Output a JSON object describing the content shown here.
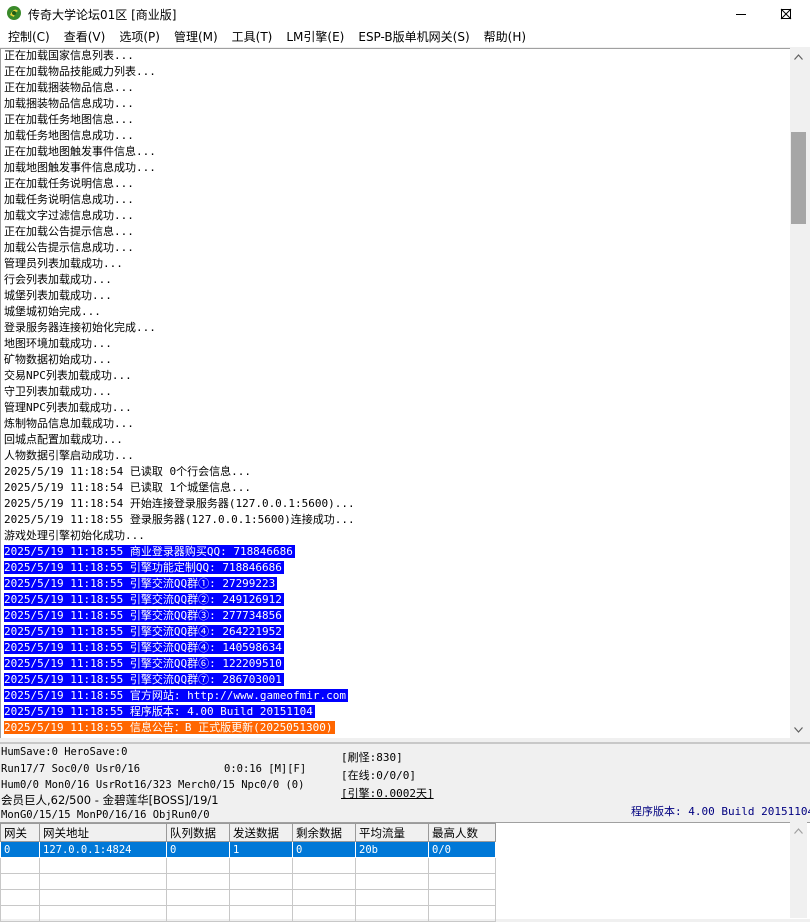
{
  "window": {
    "title": "传奇大学论坛01区 [商业版]"
  },
  "menu": [
    "控制(C)",
    "查看(V)",
    "选项(P)",
    "管理(M)",
    "工具(T)",
    "LM引擎(E)",
    "ESP-B版单机网关(S)",
    "帮助(H)"
  ],
  "log": [
    {
      "text": "正在加载国家信息列表...",
      "style": ""
    },
    {
      "text": "正在加载物品技能威力列表...",
      "style": ""
    },
    {
      "text": "正在加载捆装物品信息...",
      "style": ""
    },
    {
      "text": "加载捆装物品信息成功...",
      "style": ""
    },
    {
      "text": "正在加载任务地图信息...",
      "style": ""
    },
    {
      "text": "加载任务地图信息成功...",
      "style": ""
    },
    {
      "text": "正在加载地图触发事件信息...",
      "style": ""
    },
    {
      "text": "加载地图触发事件信息成功...",
      "style": ""
    },
    {
      "text": "正在加载任务说明信息...",
      "style": ""
    },
    {
      "text": "加载任务说明信息成功...",
      "style": ""
    },
    {
      "text": "加载文字过滤信息成功...",
      "style": ""
    },
    {
      "text": "正在加载公告提示信息...",
      "style": ""
    },
    {
      "text": "加载公告提示信息成功...",
      "style": ""
    },
    {
      "text": "管理员列表加载成功...",
      "style": ""
    },
    {
      "text": "行会列表加载成功...",
      "style": ""
    },
    {
      "text": "城堡列表加载成功...",
      "style": ""
    },
    {
      "text": "城堡城初始完成...",
      "style": ""
    },
    {
      "text": "登录服务器连接初始化完成...",
      "style": ""
    },
    {
      "text": "地图环境加载成功...",
      "style": ""
    },
    {
      "text": "矿物数据初始成功...",
      "style": ""
    },
    {
      "text": "交易NPC列表加载成功...",
      "style": ""
    },
    {
      "text": "守卫列表加载成功...",
      "style": ""
    },
    {
      "text": "管理NPC列表加载成功...",
      "style": ""
    },
    {
      "text": "炼制物品信息加载成功...",
      "style": ""
    },
    {
      "text": "回城点配置加载成功...",
      "style": ""
    },
    {
      "text": "人物数据引擎启动成功...",
      "style": ""
    },
    {
      "text": "2025/5/19 11:18:54 已读取 0个行会信息...",
      "style": ""
    },
    {
      "text": "2025/5/19 11:18:54 已读取 1个城堡信息...",
      "style": ""
    },
    {
      "text": "2025/5/19 11:18:54 开始连接登录服务器(127.0.0.1:5600)...",
      "style": ""
    },
    {
      "text": "2025/5/19 11:18:55 登录服务器(127.0.0.1:5600)连接成功...",
      "style": ""
    },
    {
      "text": "游戏处理引擎初始化成功...",
      "style": ""
    },
    {
      "text": "2025/5/19 11:18:55 商业登录器购买QQ: 718846686",
      "style": "hl-blue"
    },
    {
      "text": "2025/5/19 11:18:55 引擎功能定制QQ: 718846686",
      "style": "hl-blue"
    },
    {
      "text": "2025/5/19 11:18:55 引擎交流QQ群①: 27299223",
      "style": "hl-blue"
    },
    {
      "text": "2025/5/19 11:18:55 引擎交流QQ群②: 249126912",
      "style": "hl-blue"
    },
    {
      "text": "2025/5/19 11:18:55 引擎交流QQ群③: 277734856",
      "style": "hl-blue"
    },
    {
      "text": "2025/5/19 11:18:55 引擎交流QQ群④: 264221952",
      "style": "hl-blue"
    },
    {
      "text": "2025/5/19 11:18:55 引擎交流QQ群④: 140598634",
      "style": "hl-blue"
    },
    {
      "text": "2025/5/19 11:18:55 引擎交流QQ群⑥: 122209510",
      "style": "hl-blue"
    },
    {
      "text": "2025/5/19 11:18:55 引擎交流QQ群⑦: 286703001",
      "style": "hl-blue"
    },
    {
      "text": "2025/5/19 11:18:55 官方网站: http://www.gameofmir.com",
      "style": "hl-blue"
    },
    {
      "text": "2025/5/19 11:18:55 程序版本: 4.00 Build 20151104",
      "style": "hl-blue"
    },
    {
      "text": "2025/5/19 11:18:55 信息公告：B 正式版更新(2025051300)",
      "style": "hl-orange"
    }
  ],
  "status": {
    "line1": "HumSave:0 HeroSave:0",
    "line2": "Run17/7 Soc0/0 Usr0/16",
    "timer": "0:0:16 [M][F]",
    "line3": "Hum0/0 Mon0/16 UsrRot16/323 Merch0/15 Npc0/0 (0)",
    "line4": "会员巨人,62/500 - 金碧莲华[BOSS]/19/1",
    "line5": "MonG0/15/15 MonP0/16/16 ObjRun0/0",
    "refresh": "[刷怪:830]",
    "online": "[在线:0/0/0]",
    "engine": "[引擎:0.0002天]",
    "version": "程序版本: 4.00 Build 20151104"
  },
  "gateway_table": {
    "columns": [
      "网关",
      "网关地址",
      "队列数据",
      "发送数据",
      "剩余数据",
      "平均流量",
      "最高人数"
    ],
    "rows": [
      [
        "0",
        "127.0.0.1:4824",
        "0",
        "1",
        "0",
        "20b",
        "0/0"
      ]
    ],
    "empty_rows": 4
  },
  "colors": {
    "highlight_blue": "#0000ff",
    "highlight_orange": "#ff6600",
    "selection": "#0078d7"
  }
}
